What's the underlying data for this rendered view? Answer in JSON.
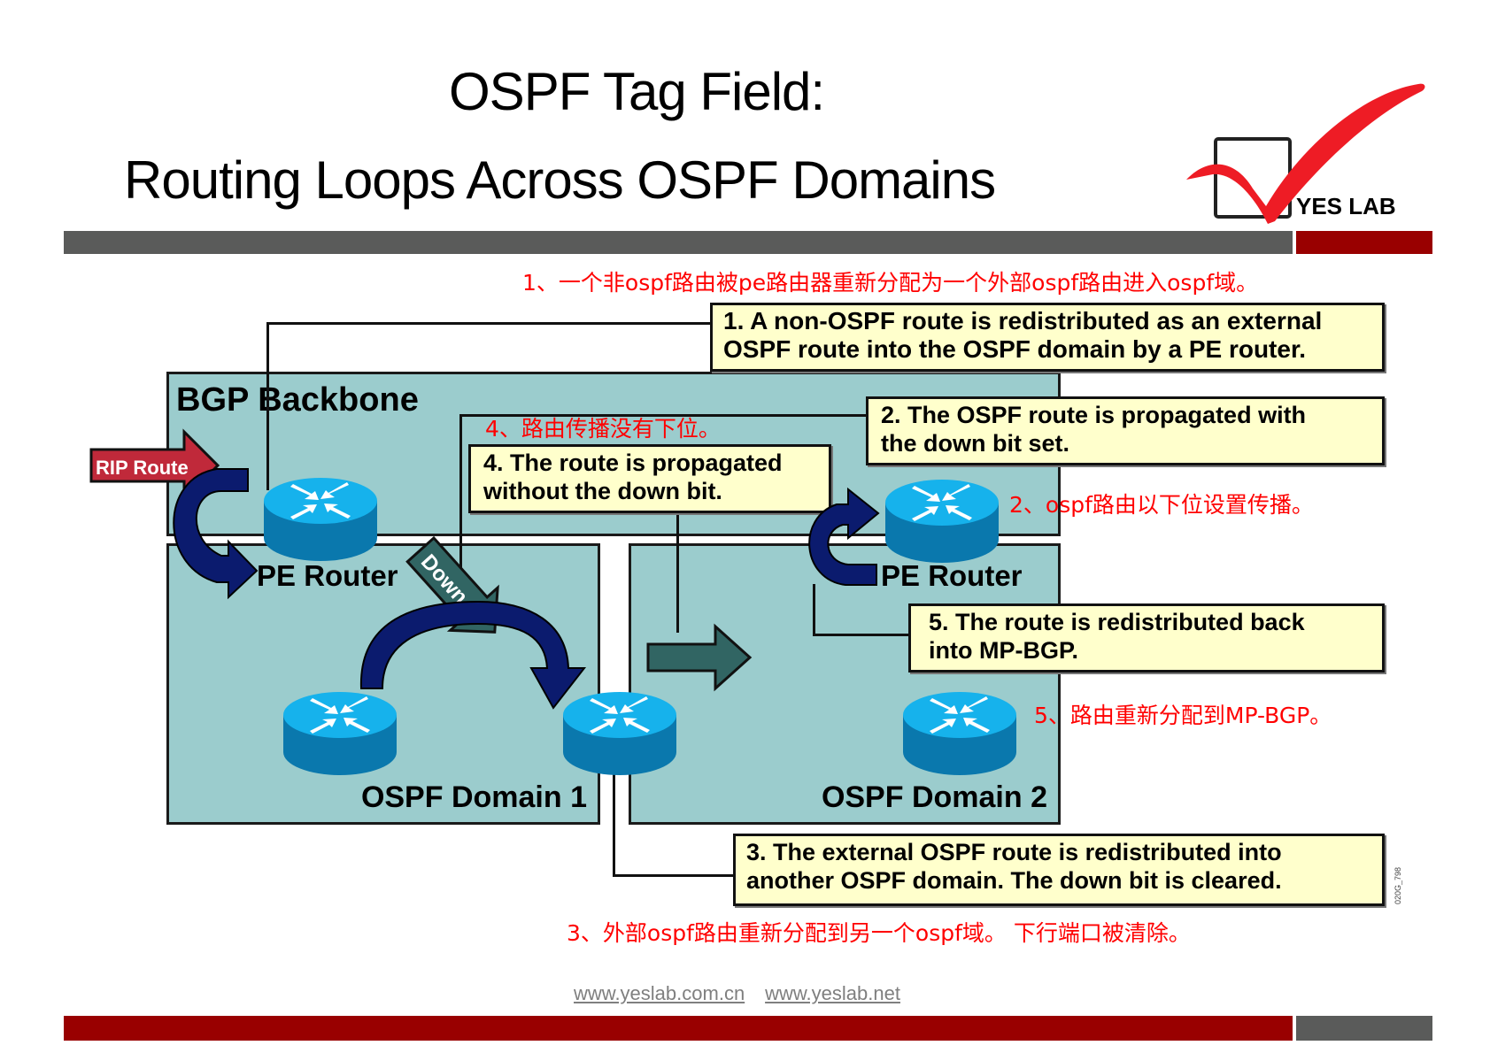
{
  "slide": {
    "title_line1": "OSPF Tag Field:",
    "title_line2": "Routing Loops Across OSPF Domains",
    "logo_text": "YES LAB",
    "colors": {
      "accent_red": "#990000",
      "bar_gray": "#5a5b5a",
      "region_fill": "#9bcccd",
      "callout_fill": "#ffffcc",
      "annotation_red": "#ff0000",
      "router_blue": "#0a9fd8"
    }
  },
  "diagram": {
    "regions": {
      "bgp_backbone": "BGP Backbone",
      "ospf_domain_1": "OSPF Domain 1",
      "ospf_domain_2": "OSPF Domain 2"
    },
    "labels": {
      "rip_route": "RIP Route",
      "pe_router_left": "PE Router",
      "pe_router_right": "PE Router",
      "down_arrow": "Down"
    },
    "callouts": {
      "step1": [
        "1. A non-OSPF route is redistributed as an external",
        "OSPF route into the OSPF domain by a PE router."
      ],
      "step2": [
        "2. The OSPF route is propagated with",
        "the down bit set."
      ],
      "step3": [
        "3. The external OSPF route is redistributed into",
        "another OSPF domain. The down bit is cleared."
      ],
      "step4": [
        "4. The route is propagated",
        "without the down bit."
      ],
      "step5": [
        "5. The route is redistributed back",
        "into MP-BGP."
      ]
    },
    "annotations_cn": {
      "step1": "1、一个非ospf路由被pe路由器重新分配为一个外部ospf路由进入ospf域。",
      "step2": "2、ospf路由以下位设置传播。",
      "step3": "3、外部ospf路由重新分配到另一个ospf域。 下行端口被清除。",
      "step4": "4、路由传播没有下位。",
      "step5": "5、路由重新分配到MP-BGP。"
    },
    "figure_id": "020G_798"
  },
  "footer": {
    "links": [
      "www.yeslab.com.cn",
      "www.yeslab.net"
    ]
  }
}
